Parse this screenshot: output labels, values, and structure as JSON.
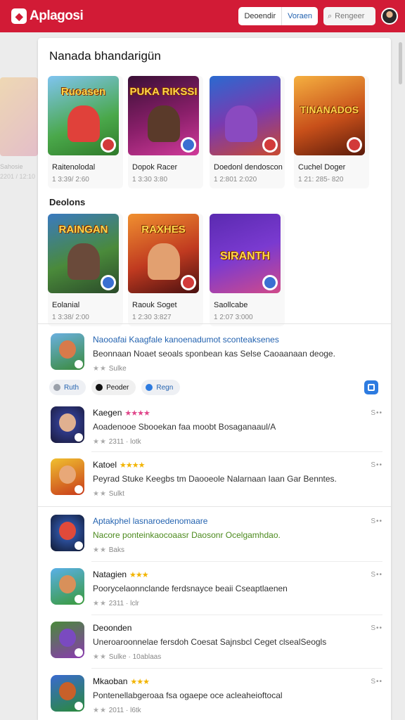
{
  "header": {
    "logo_text": "Aplagosi",
    "btn_left": "Deoendir",
    "btn_right": "Voraen",
    "search_placeholder": "Rengeer",
    "accent": "#d21b36"
  },
  "ghost": {
    "title": "Sahosie",
    "meta": "2201 / 12:10"
  },
  "featured": {
    "title": "Nanada bhandarigün",
    "tiles": [
      {
        "name": "Raitenolodal",
        "meta": "1 3:39/ 2:60",
        "art_word": "Ruoasen",
        "badge": "#d23a3a"
      },
      {
        "name": "Dopok Racer",
        "meta": "1 3:30 3:80",
        "art_word": "PUKA RIKSSI",
        "badge": "#3a6fd2"
      },
      {
        "name": "Doedonl dendoscon",
        "meta": "1 2:801 2:020",
        "art_word": "",
        "badge": "#d23a3a"
      },
      {
        "name": "Cuchel Doger",
        "meta": "1 21: 285- 820",
        "art_word": "TINANADOS",
        "badge": "#d23a3a"
      }
    ]
  },
  "second": {
    "title": "Deolons",
    "tiles": [
      {
        "name": "Eolanial",
        "meta": "1 3:38/ 2:00",
        "art_word": "RAINGAN",
        "badge": "#3a6fd2"
      },
      {
        "name": "Raouk Soget",
        "meta": "1 2:30 3:827",
        "art_word": "RAXHES",
        "badge": "#d23a3a"
      },
      {
        "name": "Saollcabe",
        "meta": "1 2:07 3:000",
        "art_word": "SIRANTH",
        "badge": "#3a6fd2"
      }
    ]
  },
  "promo": {
    "title": "Naooafai Kaagfale kanoenadumot sconteaksenes",
    "desc": "Beonnaan Noaet seoals sponbean kas Selse Caoaanaan deoge.",
    "meta": "Sulke"
  },
  "chips": [
    "Ruth",
    "Peoder",
    "Regn"
  ],
  "list": [
    {
      "title": "Kaegen",
      "stars": "★★★★",
      "desc": "Aoadenooe Sbooekan faa moobt Bosaganaaul/A",
      "meta": "2311 · lotk",
      "more": "S••"
    },
    {
      "title": "Katoel",
      "stars": "★★★★",
      "desc": "Peyrad Stuke Keegbs tm Daooeole Nalarnaan Iaan Gar Benntes.",
      "meta": "Sulkt",
      "more": "S••"
    },
    {
      "title": "Aptakphel lasnaroedenomaare",
      "stars": "",
      "desc": "Nacore ponteinkaocoaasr Daosonr Ocelgamhdao.",
      "meta": "Baks",
      "more": "S••"
    },
    {
      "title": "Natagien",
      "stars": "★★★",
      "desc": "Poorycelaonnclande ferdsnayce beaii Cseaptlaenen",
      "meta": "2311 · lclr",
      "more": "S••"
    },
    {
      "title": "Deoonden",
      "stars": "",
      "desc": "Uneroaroonnelae fersdoh Coesat Sajnsbcl Ceget clsealSeogls",
      "meta": "Sulke · 10ablaas",
      "more": "S••"
    },
    {
      "title": "Mkaoban",
      "stars": "★★★",
      "desc": "Pontenellabgeroaa fsa ogaepe oce acleaheioftocal",
      "meta": "2011 · l6tk",
      "more": "S••"
    }
  ]
}
